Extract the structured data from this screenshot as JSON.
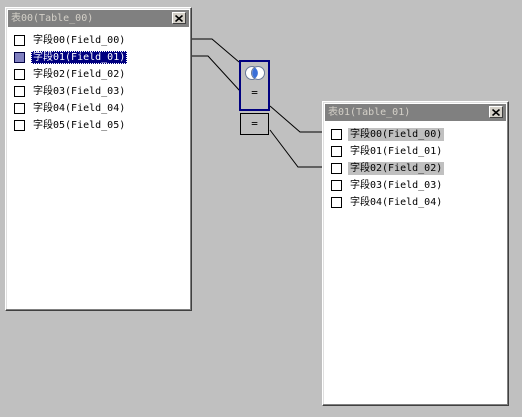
{
  "tables": [
    {
      "title": "表00(Table_00)",
      "fields": [
        {
          "label": "字段00(Field_00)",
          "checked": false,
          "state": "normal"
        },
        {
          "label": "字段01(Field_01)",
          "checked": true,
          "state": "selected"
        },
        {
          "label": "字段02(Field_02)",
          "checked": false,
          "state": "normal"
        },
        {
          "label": "字段03(Field_03)",
          "checked": false,
          "state": "normal"
        },
        {
          "label": "字段04(Field_04)",
          "checked": false,
          "state": "normal"
        },
        {
          "label": "字段05(Field_05)",
          "checked": false,
          "state": "normal"
        }
      ]
    },
    {
      "title": "表01(Table_01)",
      "fields": [
        {
          "label": "字段00(Field_00)",
          "checked": false,
          "state": "joined"
        },
        {
          "label": "字段01(Field_01)",
          "checked": false,
          "state": "normal"
        },
        {
          "label": "字段02(Field_02)",
          "checked": false,
          "state": "joined"
        },
        {
          "label": "字段03(Field_03)",
          "checked": false,
          "state": "normal"
        },
        {
          "label": "字段04(Field_04)",
          "checked": false,
          "state": "normal"
        }
      ]
    }
  ],
  "joins": [
    {
      "operator": "=",
      "selected": true,
      "icon": "venn-inner-join-icon"
    },
    {
      "operator": "=",
      "selected": false
    }
  ],
  "colors": {
    "desktop": "#c0c0c0",
    "titlebar_inactive": "#808080",
    "selection": "#000080",
    "join_highlight": "#c0c0c0"
  }
}
